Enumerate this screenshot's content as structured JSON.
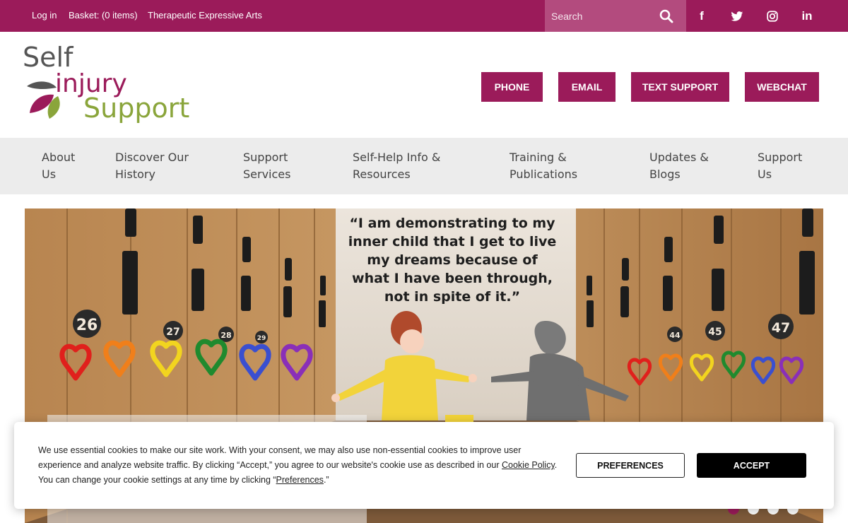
{
  "topbar": {
    "links": [
      "Log in",
      "Basket: (0 items)",
      "Therapeutic Expressive Arts"
    ],
    "search_placeholder": "Search",
    "social": [
      {
        "icon": "facebook-icon",
        "glyph": "f"
      },
      {
        "icon": "twitter-icon",
        "glyph": ""
      },
      {
        "icon": "instagram-icon",
        "glyph": ""
      },
      {
        "icon": "linkedin-icon",
        "glyph": "in"
      }
    ],
    "color": "#9b1b5a"
  },
  "logo": {
    "line1": "Self",
    "line2": "injury",
    "line3": "Support",
    "colors": {
      "grey": "#555555",
      "purple": "#9b1b5a",
      "green": "#8aa53b"
    }
  },
  "header_buttons": [
    "PHONE",
    "EMAIL",
    "TEXT SUPPORT",
    "WEBCHAT"
  ],
  "nav": [
    {
      "l1": "About",
      "l2": "Us"
    },
    {
      "l1": "Discover Our",
      "l2": "History"
    },
    {
      "l1": "Support",
      "l2": "Services"
    },
    {
      "l1": "Self-Help Info &",
      "l2": "Resources"
    },
    {
      "l1": "Training &",
      "l2": "Publications"
    },
    {
      "l1": "Updates &",
      "l2": "Blogs"
    },
    {
      "l1": "Support",
      "l2": "Us"
    }
  ],
  "hero": {
    "quote": "“I am demonstrating to my inner child that I get to live my dreams because of what I have been through, not in spite of it.”",
    "locker_numbers_left": [
      "26",
      "27",
      "28",
      "29"
    ],
    "locker_numbers_right": [
      "44",
      "45",
      "47"
    ],
    "heart_colors": [
      "#e0201c",
      "#f07f1a",
      "#f2d41f",
      "#1f8a2e",
      "#3a4fd0",
      "#8a2fb8"
    ],
    "slider_dots": 4,
    "active_dot": 0
  },
  "cookie": {
    "text_before_link": "We use essential cookies to make our site work. With your consent, we may also use non-essential cookies to improve user experience and analyze website traffic. By clicking “Accept,” you agree to our website's cookie use as described in our ",
    "policy_link": "Cookie Policy",
    "text_middle": ". You can change your cookie settings at any time by clicking “",
    "preferences_link": "Preferences",
    "text_end": ".”",
    "preferences_button": "PREFERENCES",
    "accept_button": "ACCEPT"
  }
}
